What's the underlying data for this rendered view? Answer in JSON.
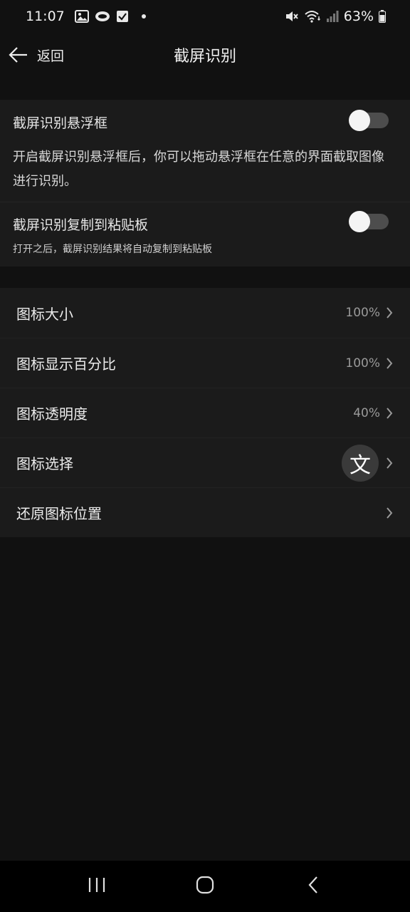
{
  "status_bar": {
    "time": "11:07",
    "battery": "63%",
    "icons": [
      "gallery-icon",
      "cloud-icon",
      "checkbox-icon",
      "notification-dot",
      "mute-icon",
      "wifi-icon",
      "signal-icon",
      "battery-icon"
    ]
  },
  "header": {
    "back_label": "返回",
    "title": "截屏识别"
  },
  "floating_window": {
    "title": "截屏识别悬浮框",
    "description": "开启截屏识别悬浮框后，你可以拖动悬浮框在任意的界面截取图像进行识别。",
    "enabled": false
  },
  "copy_to_clipboard": {
    "title": "截屏识别复制到粘贴板",
    "description": "打开之后，截屏识别结果将自动复制到粘贴板",
    "enabled": false
  },
  "settings": [
    {
      "label": "图标大小",
      "value": "100%"
    },
    {
      "label": "图标显示百分比",
      "value": "100%"
    },
    {
      "label": "图标透明度",
      "value": "40%"
    },
    {
      "label": "图标选择",
      "icon_glyph": "文"
    },
    {
      "label": "还原图标位置"
    }
  ],
  "colors": {
    "background": "#111111",
    "card": "#1b1b1b",
    "toggle_off_track": "#4d4d4d",
    "toggle_knob": "#f4f4f4",
    "secondary_text": "#9a9a9a"
  },
  "nav_bar": {
    "buttons": [
      "recent-apps",
      "home",
      "back"
    ]
  }
}
